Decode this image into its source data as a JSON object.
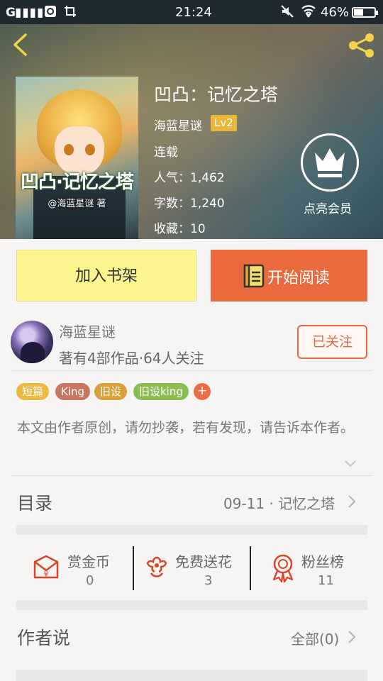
{
  "status_bar": {
    "signal": "G",
    "time": "21:24",
    "battery": "46%"
  },
  "book": {
    "title": "凹凸：记忆之塔",
    "author": "海蓝星谜",
    "level": "Lv2",
    "status": "连载",
    "popularity": "人气：1,462",
    "word_count": "字数：1,240",
    "favorites": "收藏：10",
    "cover_title": "凹凸·记忆之塔",
    "cover_subtitle": "@海蓝星谜 著"
  },
  "vip": {
    "label": "点亮会员"
  },
  "actions": {
    "add_shelf": "加入书架",
    "start_read": "开始阅读"
  },
  "author": {
    "name": "海蓝星谜",
    "meta": "著有4部作品·64人关注",
    "follow": "已关注"
  },
  "tags": [
    {
      "label": "短篇",
      "color": "#eab93f"
    },
    {
      "label": "King",
      "color": "#c7765f"
    },
    {
      "label": "旧设",
      "color": "#d6a23b"
    },
    {
      "label": "旧设king",
      "color": "#8bbd52"
    }
  ],
  "tag_add": "+",
  "description": "本文由作者原创，请勿抄袭，若有发现，请告诉本作者。",
  "toc": {
    "label": "目录",
    "latest": "09-11 · 记忆之塔"
  },
  "stats": [
    {
      "label": "赏金币",
      "value": "0",
      "icon": "coin-envelope-icon"
    },
    {
      "label": "免费送花",
      "value": "3",
      "icon": "flower-icon"
    },
    {
      "label": "粉丝榜",
      "value": "11",
      "icon": "medal-icon"
    }
  ],
  "author_says": {
    "label": "作者说",
    "all": "全部(0)"
  },
  "colors": {
    "accent": "#ea6a3e",
    "shelf_button": "#fbf58f",
    "level_badge": "#e9b83a"
  }
}
